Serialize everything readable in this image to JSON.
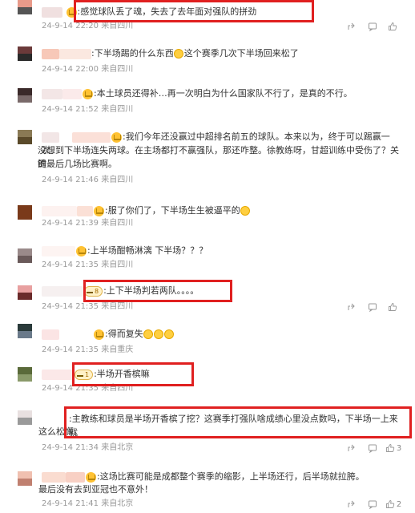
{
  "comments": [
    {
      "text": ":感觉球队丢了魂，失去了去年面对强队的拼劲",
      "time": "24-9-14 22:20",
      "location": "来自四川",
      "likes": "",
      "avatar": [
        "#e89a8a",
        "#555555"
      ]
    },
    {
      "text": ":下半场踢的什么东西",
      "text2": "这个赛季几次下半场回来松了",
      "time": "24-9-14 22:00",
      "location": "来自四川",
      "likes": "",
      "avatar": [
        "#6b3a3a",
        "#2a2a2a"
      ]
    },
    {
      "text": ":本土球员还得补…再一次明白为什么国家队不行了，是真的不行。",
      "time": "24-9-14 21:52",
      "location": "来自四川",
      "likes": "",
      "avatar": [
        "#3b2a2a",
        "#7a6a6a"
      ]
    },
    {
      "text": ":我们今年还没赢过中超排名前五的球队。本来以为，终于可以踢赢一次。",
      "line2": "没想到下半场连失两球。在主场都打不赢强队，那还咋整。徐教练呀，甘超训练中受伤了？关键",
      "line3": "的最后几场比赛啊。",
      "time": "24-9-14 21:46",
      "location": "来自四川",
      "likes": "",
      "avatar": [
        "#8a7a55",
        "#5a4a2a"
      ]
    },
    {
      "text": ":服了你们了，下半场生生被逼平的",
      "time": "24-9-14 21:39",
      "location": "来自四川",
      "likes": "",
      "avatar": [
        "#7a3a1a",
        "#7a3a1a"
      ]
    },
    {
      "text": ":上半场酣畅淋漓 下半场？？？",
      "time": "24-9-14 21:35",
      "location": "来自四川",
      "likes": "",
      "avatar": [
        "#9a8a8a",
        "#6a5a5a"
      ]
    },
    {
      "text": ":上下半场判若两队。。。。",
      "time": "24-9-14 21:35",
      "location": "来自四川",
      "likes": "",
      "avatar": [
        "#e8a0a0",
        "#6a2a2a"
      ]
    },
    {
      "text": ":得而复失",
      "time": "24-9-14 21:35",
      "location": "来自重庆",
      "likes": "",
      "avatar": [
        "#2a3a3a",
        "#6a7a8a"
      ]
    },
    {
      "text": ":半场开香槟嘛",
      "time": "24-9-14 21:35",
      "location": "来自四川",
      "likes": "",
      "avatar": [
        "#5a6a3a",
        "#8a9a6a"
      ]
    },
    {
      "text": ":主教练和球员是半场开香槟了挖？这赛季打强队啥成绩心里没点数吗，下半场一上来就",
      "line2": "这么松懈。",
      "time": "24-9-14 21:34",
      "location": "来自北京",
      "likes": "3",
      "avatar": [
        "#e8e0e0",
        "#9a9a9a"
      ]
    },
    {
      "text": ":这场比赛可能是成都整个赛季的缩影，上半场还行，后半场就拉胯。",
      "line2": "最后没有去到亚冠也不意外！",
      "time": "24-9-14 21:41",
      "location": "来自北京",
      "likes": "2",
      "avatar": [
        "#f0c0b0",
        "#c08070"
      ]
    }
  ],
  "colors": {
    "highlight": "#e02020",
    "meta": "#999999",
    "text": "#333333"
  },
  "icons": {
    "share": "share-icon",
    "comment": "comment-icon",
    "like": "thumbs-up-icon"
  }
}
